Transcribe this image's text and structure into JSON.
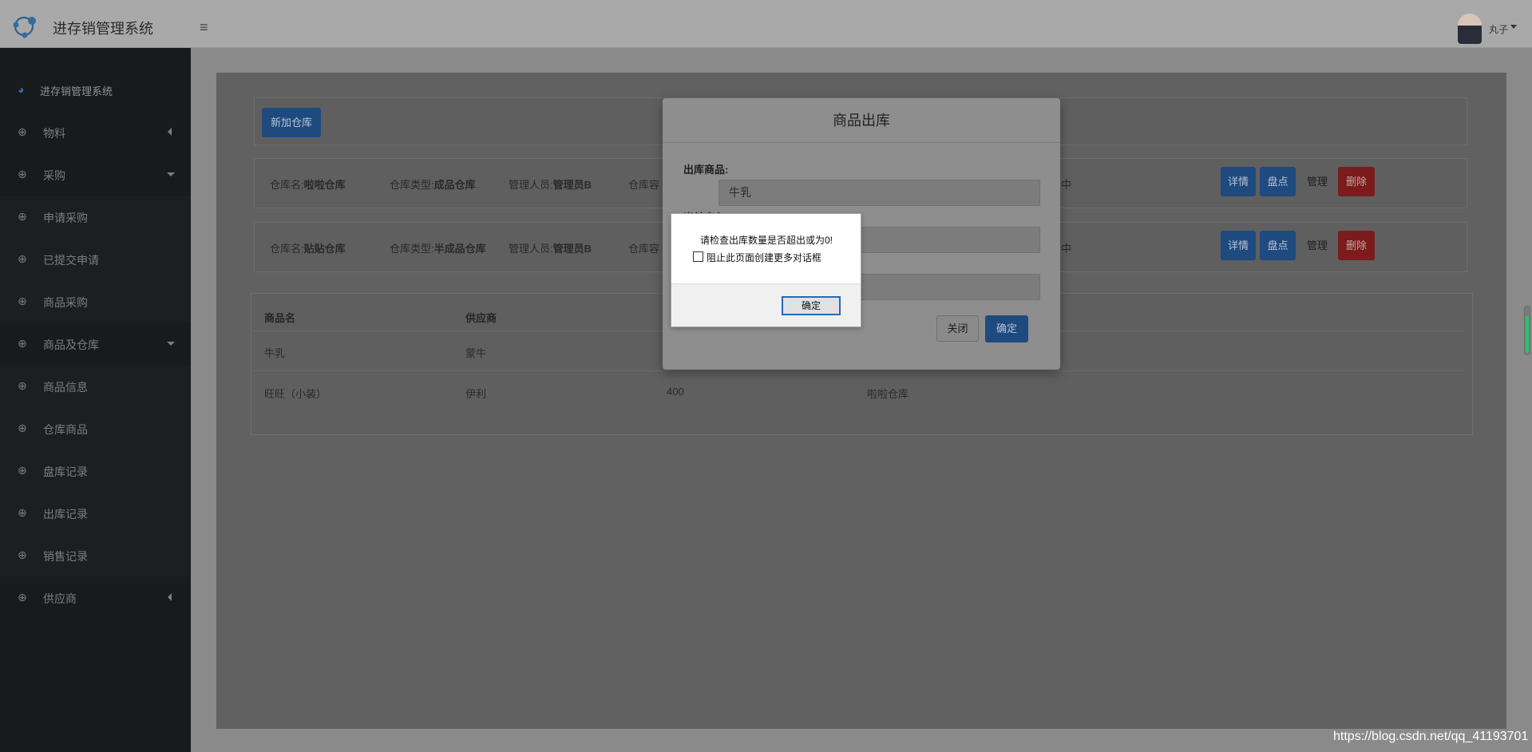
{
  "header": {
    "brand": "进存销管理系统",
    "user_name": "丸子"
  },
  "sidebar": {
    "items": [
      {
        "label": "进存销管理系统",
        "icon": "dashboard-icon",
        "arrow": "none"
      },
      {
        "label": "物料",
        "icon": "crosshair-icon",
        "arrow": "left"
      },
      {
        "label": "采购",
        "icon": "crosshair-icon",
        "arrow": "down"
      },
      {
        "label": "申请采购",
        "icon": "crosshair-icon",
        "arrow": "none"
      },
      {
        "label": "已提交申请",
        "icon": "crosshair-icon",
        "arrow": "none"
      },
      {
        "label": "商品采购",
        "icon": "crosshair-icon",
        "arrow": "none"
      },
      {
        "label": "商品及仓库",
        "icon": "crosshair-icon",
        "arrow": "down"
      },
      {
        "label": "商品信息",
        "icon": "crosshair-icon",
        "arrow": "none"
      },
      {
        "label": "仓库商品",
        "icon": "crosshair-icon",
        "arrow": "none"
      },
      {
        "label": "盘库记录",
        "icon": "crosshair-icon",
        "arrow": "none"
      },
      {
        "label": "出库记录",
        "icon": "crosshair-icon",
        "arrow": "none"
      },
      {
        "label": "销售记录",
        "icon": "crosshair-icon",
        "arrow": "none"
      },
      {
        "label": "供应商",
        "icon": "crosshair-icon",
        "arrow": "left"
      }
    ]
  },
  "main": {
    "add_warehouse_label": "新加仓库",
    "warehouses": [
      {
        "name_prefix": "仓库名:",
        "name": "啦啦仓库",
        "type_prefix": "仓库类型:",
        "type": "成品仓库",
        "manager_prefix": "管理人员:",
        "manager": "管理员B",
        "capacity_prefix": "仓库容",
        "tail": "中"
      },
      {
        "name_prefix": "仓库名:",
        "name": "贴贴仓库",
        "type_prefix": "仓库类型:",
        "type": "半成品仓库",
        "manager_prefix": "管理人员:",
        "manager": "管理员B",
        "capacity_prefix": "仓库容",
        "tail": "中"
      }
    ],
    "row_actions": {
      "detail": "详情",
      "stocktake": "盘点",
      "manage": "管理",
      "delete": "删除"
    },
    "table": {
      "headers": [
        "商品名",
        "供应商"
      ],
      "rows": [
        {
          "name": "牛乳",
          "supplier": "蒙牛",
          "quantity": "",
          "warehouse": ""
        },
        {
          "name": "旺旺（小装）",
          "supplier": "伊利",
          "quantity": "400",
          "warehouse": "啦啦仓库"
        }
      ]
    }
  },
  "modal": {
    "title": "商品出库",
    "product_label": "出库商品:",
    "product_value": "牛乳",
    "second_label": "当前库存:",
    "close_label": "关闭",
    "confirm_label": "确定"
  },
  "alert": {
    "message": "请检查出库数量是否超出或为0!",
    "checkbox_label": "阻止此页面创建更多对话框",
    "ok_label": "确定"
  },
  "watermark": "https://blog.csdn.net/qq_41193701"
}
